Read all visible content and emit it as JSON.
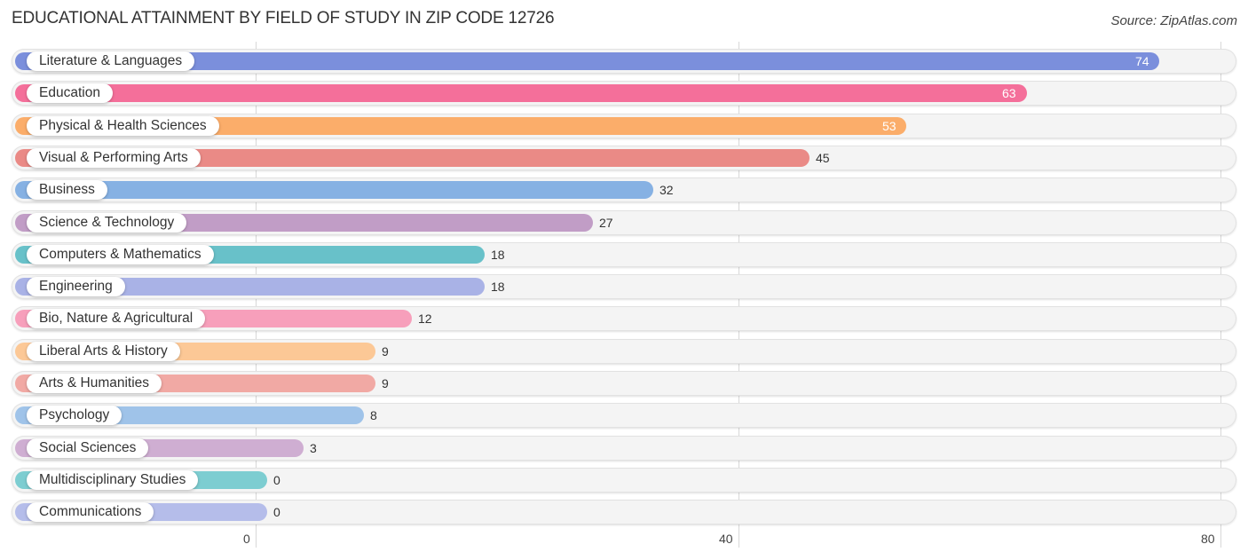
{
  "header": {
    "title": "EDUCATIONAL ATTAINMENT BY FIELD OF STUDY IN ZIP CODE 12726",
    "source": "Source: ZipAtlas.com"
  },
  "chart_data": {
    "type": "bar",
    "orientation": "horizontal",
    "title": "EDUCATIONAL ATTAINMENT BY FIELD OF STUDY IN ZIP CODE 12726",
    "xlabel": "",
    "ylabel": "",
    "xlim": [
      0,
      80
    ],
    "xticks": [
      0,
      40,
      80
    ],
    "xtick_labels": [
      "0",
      "40",
      "80"
    ],
    "grid": true,
    "categories": [
      "Literature & Languages",
      "Education",
      "Physical & Health Sciences",
      "Visual & Performing Arts",
      "Business",
      "Science & Technology",
      "Computers & Mathematics",
      "Engineering",
      "Bio, Nature & Agricultural",
      "Liberal Arts & History",
      "Arts & Humanities",
      "Psychology",
      "Social Sciences",
      "Multidisciplinary Studies",
      "Communications"
    ],
    "values": [
      74,
      63,
      53,
      45,
      32,
      27,
      18,
      18,
      12,
      9,
      9,
      8,
      3,
      0,
      0
    ],
    "value_labels": [
      "74",
      "63",
      "53",
      "45",
      "32",
      "27",
      "18",
      "18",
      "12",
      "9",
      "9",
      "8",
      "3",
      "0",
      "0"
    ],
    "colors": [
      "#7b8fdc",
      "#f46f9a",
      "#fbad6a",
      "#ea8a86",
      "#86b1e3",
      "#c19dc6",
      "#68c1c9",
      "#a9b2e6",
      "#f79fbb",
      "#fcc896",
      "#f1a9a4",
      "#9fc3e9",
      "#cfaed2",
      "#7dcdd1",
      "#b5bdea"
    ],
    "source": "Source: ZipAtlas.com"
  }
}
